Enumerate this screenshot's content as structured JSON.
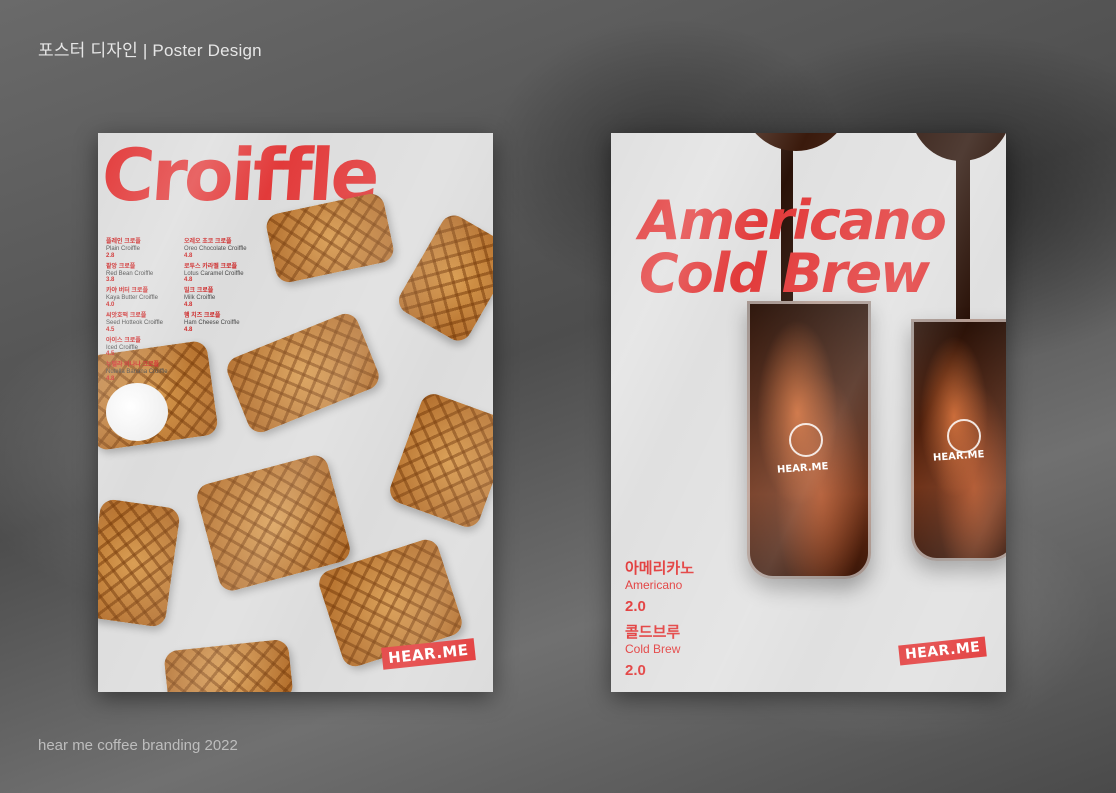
{
  "header": {
    "title": "포스터 디자인 | Poster Design"
  },
  "footer": {
    "caption": "hear me coffee branding 2022"
  },
  "poster_croiffle": {
    "title": "Croiffle",
    "menu_left": [
      {
        "ko": "플레인 크로플",
        "en": "Plain Croiffle",
        "price": "2.8"
      },
      {
        "ko": "팥앙 크로플",
        "en": "Red Bean Croiffle",
        "price": "3.8"
      },
      {
        "ko": "카야 버터 크로플",
        "en": "Kaya Butter Croiffle",
        "price": "4.0"
      },
      {
        "ko": "씨앗호떡 크로플",
        "en": "Seed Hotteok Croiffle",
        "price": "4.5"
      },
      {
        "ko": "아이스 크로플",
        "en": "Iced Croiffle",
        "price": "4.5"
      },
      {
        "ko": "누텔라 바나나 크로플",
        "en": "Nutella Banana Croiffle",
        "price": "4.8"
      }
    ],
    "menu_right": [
      {
        "ko": "오레오 초코 크로플",
        "en": "Oreo Chocolate Croiffle",
        "price": "4.8"
      },
      {
        "ko": "로투스 카라멜 크로플",
        "en": "Lotus Caramel Croiffle",
        "price": "4.8"
      },
      {
        "ko": "밀크 크로플",
        "en": "Milk Croiffle",
        "price": "4.8"
      },
      {
        "ko": "햄 치즈 크로플",
        "en": "Ham Cheese Croiffle",
        "price": "4.8"
      }
    ],
    "logo": "HEAR.ME"
  },
  "poster_coffee": {
    "title_line1": "Americano",
    "title_line2": "Cold Brew",
    "glass_label": "HEAR.ME",
    "items": [
      {
        "ko": "아메리카노",
        "en": "Americano",
        "price": "2.0"
      },
      {
        "ko": "콜드브루",
        "en": "Cold Brew",
        "price": "2.0"
      }
    ],
    "logo": "HEAR.ME"
  },
  "colors": {
    "brand_red": "#e23a3a",
    "background": "#5b5b5b"
  }
}
